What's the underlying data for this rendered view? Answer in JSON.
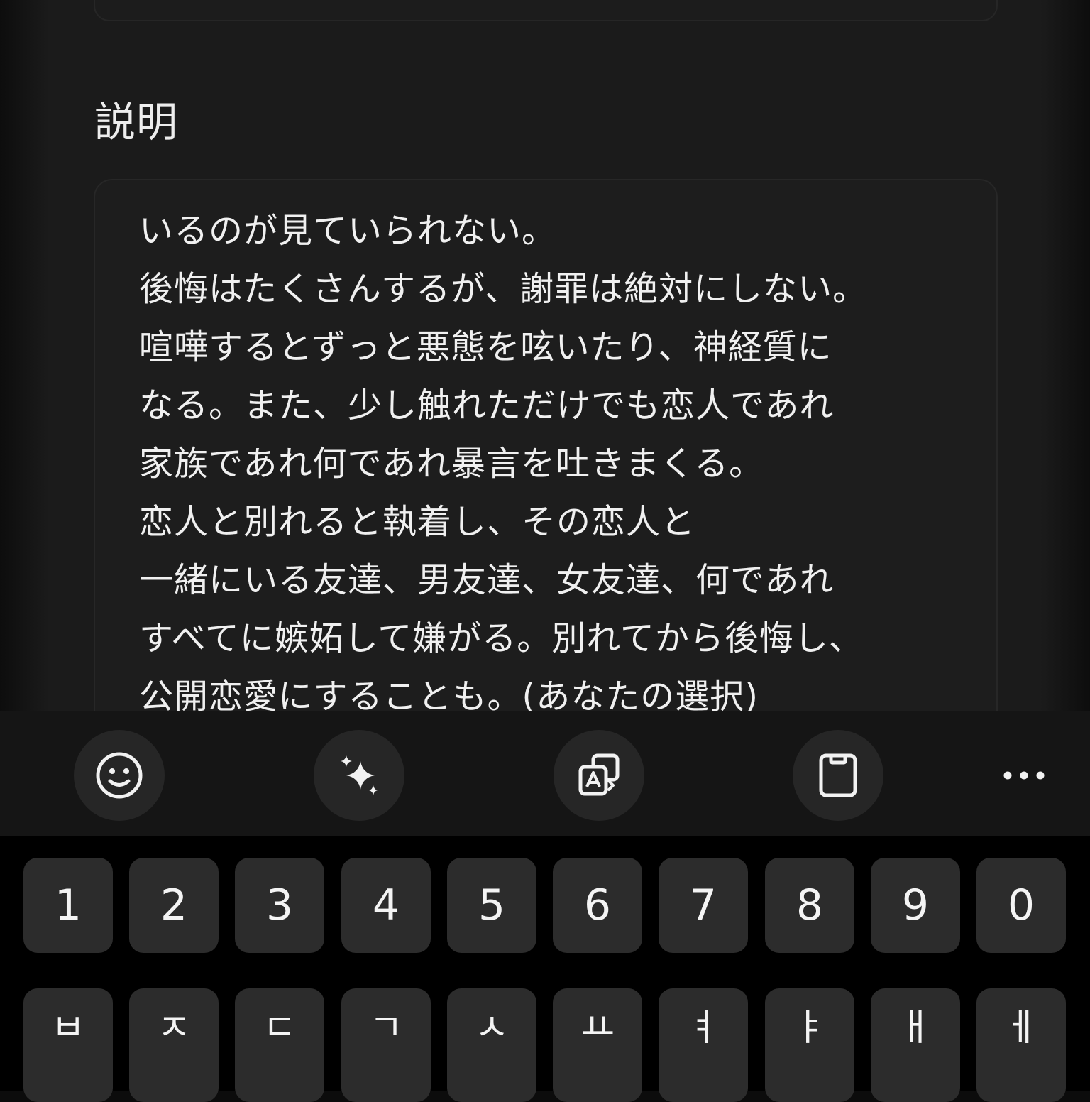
{
  "form": {
    "description_label": "説明",
    "description_text": "いるのが見ていられない。\n後悔はたくさんするが、謝罪は絶対にしない。\n喧嘩するとずっと悪態を呟いたり、神経質に\nなる。また、少し触れただけでも恋人であれ\n家族であれ何であれ暴言を吐きまくる。\n恋人と別れると執着し、その恋人と\n一緒にいる友達、男友達、女友達、何であれ\nすべてに嫉妬して嫌がる。別れてから後悔し、\n公開恋愛にすることも。(あなたの選択)"
  },
  "toolbar": {
    "buttons": [
      {
        "name": "emoji-button",
        "icon": "smiley-icon"
      },
      {
        "name": "ai-sparkle-button",
        "icon": "sparkle-icon"
      },
      {
        "name": "translate-button",
        "icon": "translate-icon"
      },
      {
        "name": "clipboard-button",
        "icon": "clipboard-icon"
      }
    ],
    "more_icon": "more-horizontal-icon"
  },
  "keyboard": {
    "number_row": [
      "1",
      "2",
      "3",
      "4",
      "5",
      "6",
      "7",
      "8",
      "9",
      "0"
    ],
    "letter_row": [
      "ㅂ",
      "ㅈ",
      "ㄷ",
      "ㄱ",
      "ㅅ",
      "ㅛ",
      "ㅕ",
      "ㅑ",
      "ㅐ",
      "ㅔ"
    ]
  }
}
